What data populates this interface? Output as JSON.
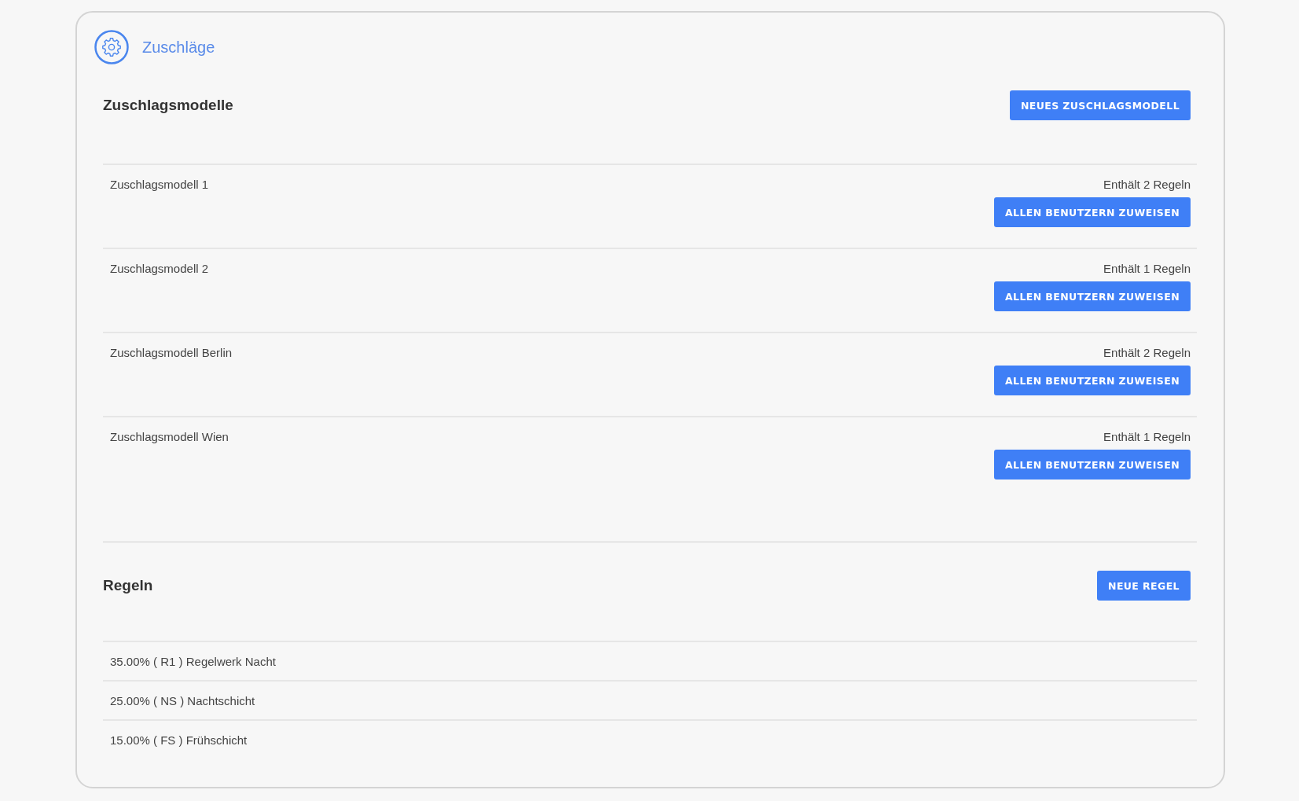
{
  "header": {
    "title": "Zuschläge"
  },
  "models": {
    "title": "Zuschlagsmodelle",
    "new_button": "NEUES ZUSCHLAGSMODELL",
    "items": [
      {
        "name": "Zuschlagsmodell 1",
        "summary": "Enthält 2 Regeln",
        "button": "ALLEN BENUTZERN ZUWEISEN"
      },
      {
        "name": "Zuschlagsmodell 2",
        "summary": "Enthält 1 Regeln",
        "button": "ALLEN BENUTZERN ZUWEISEN"
      },
      {
        "name": "Zuschlagsmodell Berlin",
        "summary": "Enthält 2 Regeln",
        "button": "ALLEN BENUTZERN ZUWEISEN"
      },
      {
        "name": "Zuschlagsmodell Wien",
        "summary": "Enthält 1 Regeln",
        "button": "ALLEN BENUTZERN ZUWEISEN"
      }
    ]
  },
  "rules": {
    "title": "Regeln",
    "new_button": "NEUE REGEL",
    "items": [
      "35.00% ( R1 ) Regelwerk Nacht",
      "25.00% ( NS ) Nachtschicht",
      "15.00% ( FS ) Frühschicht"
    ]
  }
}
